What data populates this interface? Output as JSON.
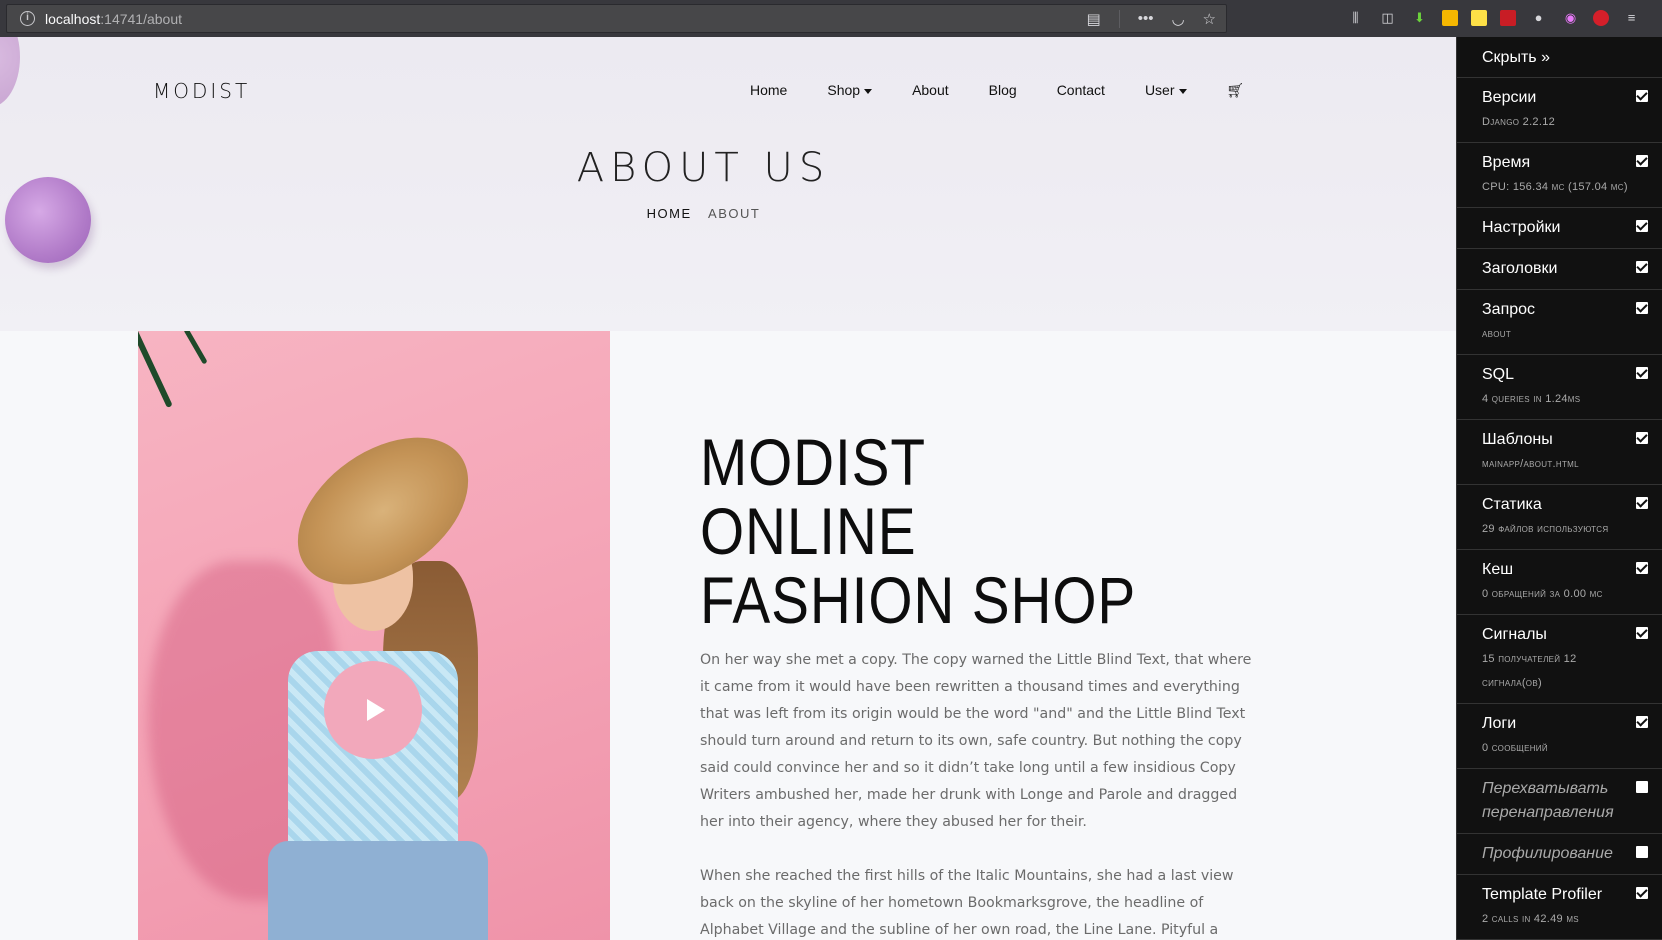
{
  "browser": {
    "url_host": "localhost",
    "url_rest": ":14741/about"
  },
  "site": {
    "brand": "MODIST",
    "nav": {
      "home": "Home",
      "shop": "Shop",
      "about": "About",
      "blog": "Blog",
      "contact": "Contact",
      "user": "User"
    },
    "hero_title": "ABOUT US",
    "breadcrumb": {
      "home": "HOME",
      "current": "ABOUT"
    },
    "heading_lines": [
      "MODIST",
      "ONLINE",
      "FASHION SHOP"
    ],
    "paragraph_1": "On her way she met a copy. The copy warned the Little Blind Text, that where it came from it would have been rewritten a thousand times and everything that was left from its origin would be the word \"and\" and the Little Blind Text should turn around and return to its own, safe country. But nothing the copy said could convince her and so it didn’t take long until a few insidious Copy Writers ambushed her, made her drunk with Longe and Parole and dragged her into their agency, where they abused her for their.",
    "paragraph_2": "When she reached the first hills of the Italic Mountains, she had a last view back on the skyline of her hometown Bookmarksgrove, the headline of Alphabet Village and the subline of her own road, the Line Lane. Pityful a rethoric question ran over her cheek,"
  },
  "debug_toolbar": {
    "hide_label": "Скрыть »",
    "panels": [
      {
        "title": "Версии",
        "subtitle": "Django 2.2.12",
        "checked": true
      },
      {
        "title": "Время",
        "subtitle": "CPU: 156.34 мс (157.04 мс)",
        "checked": true
      },
      {
        "title": "Настройки",
        "subtitle": "",
        "checked": true
      },
      {
        "title": "Заголовки",
        "subtitle": "",
        "checked": true
      },
      {
        "title": "Запрос",
        "subtitle": "about",
        "checked": true
      },
      {
        "title": "SQL",
        "subtitle": "4 queries in 1.24ms",
        "checked": true
      },
      {
        "title": "Шаблоны",
        "subtitle": "mainapp/about.html",
        "checked": true
      },
      {
        "title": "Статика",
        "subtitle": "29 файлов используются",
        "checked": true
      },
      {
        "title": "Кеш",
        "subtitle": "0 обращений за 0.00 мс",
        "checked": true
      },
      {
        "title": "Сигналы",
        "subtitle": "15 получателей 12 сигнала(ов)",
        "checked": true
      },
      {
        "title": "Логи",
        "subtitle": "0 сообщений",
        "checked": true
      },
      {
        "title": "Перехватывать перенаправления",
        "subtitle": "",
        "checked": false
      },
      {
        "title": "Профилирование",
        "subtitle": "",
        "checked": false
      },
      {
        "title": "Template Profiler",
        "subtitle": "2 calls in 42.49 ms",
        "checked": true
      }
    ]
  },
  "colors": {
    "hero_bg": "#eceaf1",
    "photo_bg": "#f5a6b8",
    "play_button": "#f2a8bb",
    "toolbar_bg": "#111111"
  },
  "icons": [
    "info-icon",
    "reader-icon",
    "more-icon",
    "pocket-icon",
    "star-icon",
    "library-icon",
    "sidebar-icon",
    "download-icon",
    "cart-icon",
    "play-icon",
    "checkbox-icon"
  ]
}
